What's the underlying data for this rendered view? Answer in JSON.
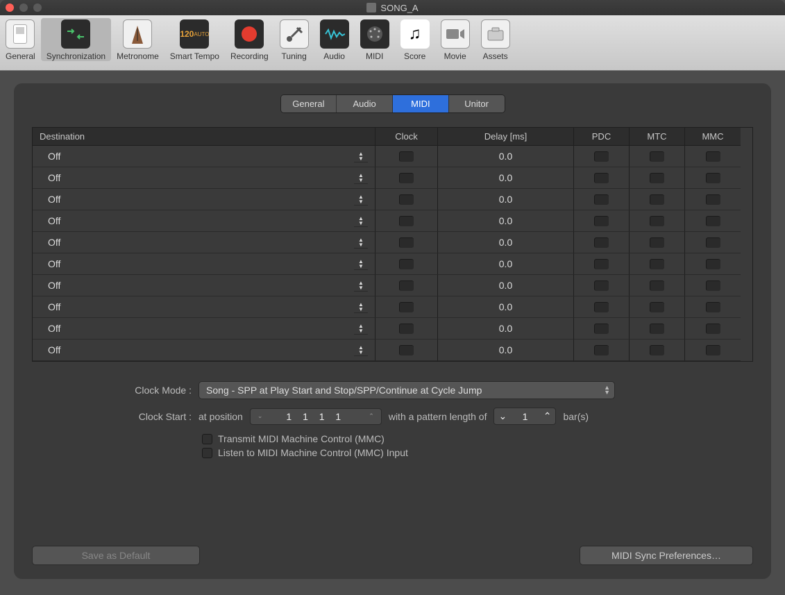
{
  "window": {
    "title": "SONG_A"
  },
  "toolbar": {
    "items": [
      {
        "label": "General",
        "icon": "switch",
        "dark": false
      },
      {
        "label": "Synchronization",
        "icon": "sync",
        "dark": true,
        "selected": true
      },
      {
        "label": "Metronome",
        "icon": "metronome",
        "dark": false
      },
      {
        "label": "Smart Tempo",
        "icon": "120 AUTO",
        "dark": true,
        "color": "#e8a33a"
      },
      {
        "label": "Recording",
        "icon": "record",
        "dark": true
      },
      {
        "label": "Tuning",
        "icon": "tuning",
        "dark": false
      },
      {
        "label": "Audio",
        "icon": "wave",
        "dark": true
      },
      {
        "label": "MIDI",
        "icon": "midi",
        "dark": true
      },
      {
        "label": "Score",
        "icon": "score",
        "dark": false
      },
      {
        "label": "Movie",
        "icon": "movie",
        "dark": false
      },
      {
        "label": "Assets",
        "icon": "assets",
        "dark": false
      }
    ]
  },
  "segmented": {
    "items": [
      "General",
      "Audio",
      "MIDI",
      "Unitor"
    ],
    "active": "MIDI"
  },
  "table": {
    "headers": {
      "destination": "Destination",
      "clock": "Clock",
      "delay": "Delay [ms]",
      "pdc": "PDC",
      "mtc": "MTC",
      "mmc": "MMC"
    },
    "rows": [
      {
        "dest": "Off",
        "clock": false,
        "delay": "0.0",
        "pdc": false,
        "mtc": false,
        "mmc": false
      },
      {
        "dest": "Off",
        "clock": false,
        "delay": "0.0",
        "pdc": false,
        "mtc": false,
        "mmc": false
      },
      {
        "dest": "Off",
        "clock": false,
        "delay": "0.0",
        "pdc": false,
        "mtc": false,
        "mmc": false
      },
      {
        "dest": "Off",
        "clock": false,
        "delay": "0.0",
        "pdc": false,
        "mtc": false,
        "mmc": false
      },
      {
        "dest": "Off",
        "clock": false,
        "delay": "0.0",
        "pdc": false,
        "mtc": false,
        "mmc": false
      },
      {
        "dest": "Off",
        "clock": false,
        "delay": "0.0",
        "pdc": false,
        "mtc": false,
        "mmc": false
      },
      {
        "dest": "Off",
        "clock": false,
        "delay": "0.0",
        "pdc": false,
        "mtc": false,
        "mmc": false
      },
      {
        "dest": "Off",
        "clock": false,
        "delay": "0.0",
        "pdc": false,
        "mtc": false,
        "mmc": false
      },
      {
        "dest": "Off",
        "clock": false,
        "delay": "0.0",
        "pdc": false,
        "mtc": false,
        "mmc": false
      },
      {
        "dest": "Off",
        "clock": false,
        "delay": "0.0",
        "pdc": false,
        "mtc": false,
        "mmc": false
      }
    ]
  },
  "form": {
    "clock_mode_label": "Clock Mode :",
    "clock_mode_value": "Song - SPP at Play Start and Stop/SPP/Continue at Cycle Jump",
    "clock_start_label": "Clock Start :",
    "at_position": "at position",
    "position_value": "1 1 1    1",
    "pattern_length_text": "with a pattern length of",
    "pattern_value": "1",
    "bars": "bar(s)",
    "transmit_mmc": "Transmit MIDI Machine Control (MMC)",
    "listen_mmc": "Listen to MIDI Machine Control (MMC) Input"
  },
  "footer": {
    "save_default": "Save as Default",
    "midi_sync_prefs": "MIDI Sync Preferences…"
  }
}
